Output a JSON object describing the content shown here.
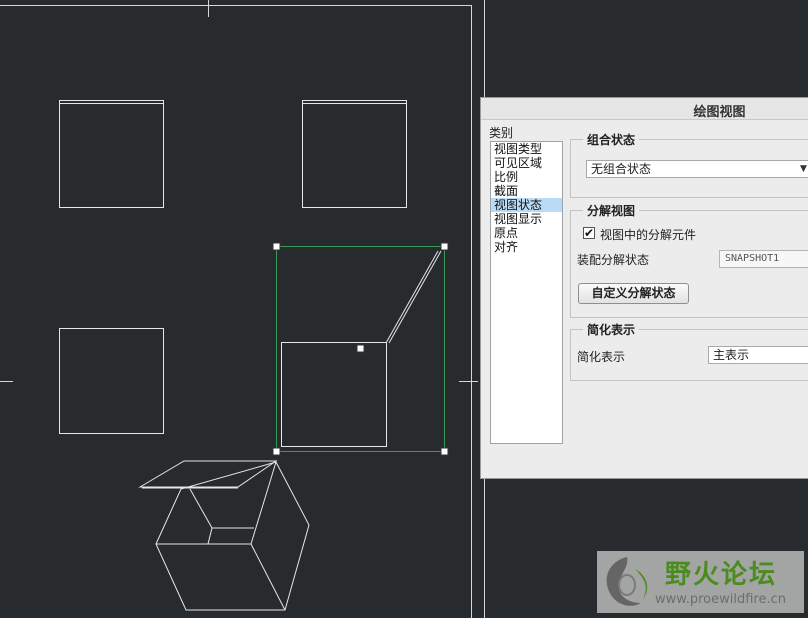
{
  "dialog": {
    "title": "绘图视图",
    "category_label": "类别",
    "categories": [
      {
        "label": "视图类型",
        "selected": false
      },
      {
        "label": "可见区域",
        "selected": false
      },
      {
        "label": "比例",
        "selected": false
      },
      {
        "label": "截面",
        "selected": false
      },
      {
        "label": "视图状态",
        "selected": true
      },
      {
        "label": "视图显示",
        "selected": false
      },
      {
        "label": "原点",
        "selected": false
      },
      {
        "label": "对齐",
        "selected": false
      }
    ],
    "combined_state": {
      "title": "组合状态",
      "value": "无组合状态"
    },
    "explode_view": {
      "title": "分解视图",
      "checkbox_label": "视图中的分解元件",
      "checked": true,
      "assembly_state_label": "装配分解状态",
      "assembly_state_value": "SNAPSHOT1",
      "custom_button": "自定义分解状态"
    },
    "simplified_rep": {
      "title": "简化表示",
      "label": "简化表示",
      "value": "主表示"
    }
  },
  "watermark": {
    "title": "野火论坛",
    "url": "www.proewildfire.cn"
  },
  "colors": {
    "canvas_bg": "#282b2e",
    "geometry": "#e6e6e6",
    "selection": "#3b9a55",
    "dialog_bg": "#ececec",
    "list_selected": "#b9dbf5",
    "watermark_green": "#4c8c1f"
  }
}
